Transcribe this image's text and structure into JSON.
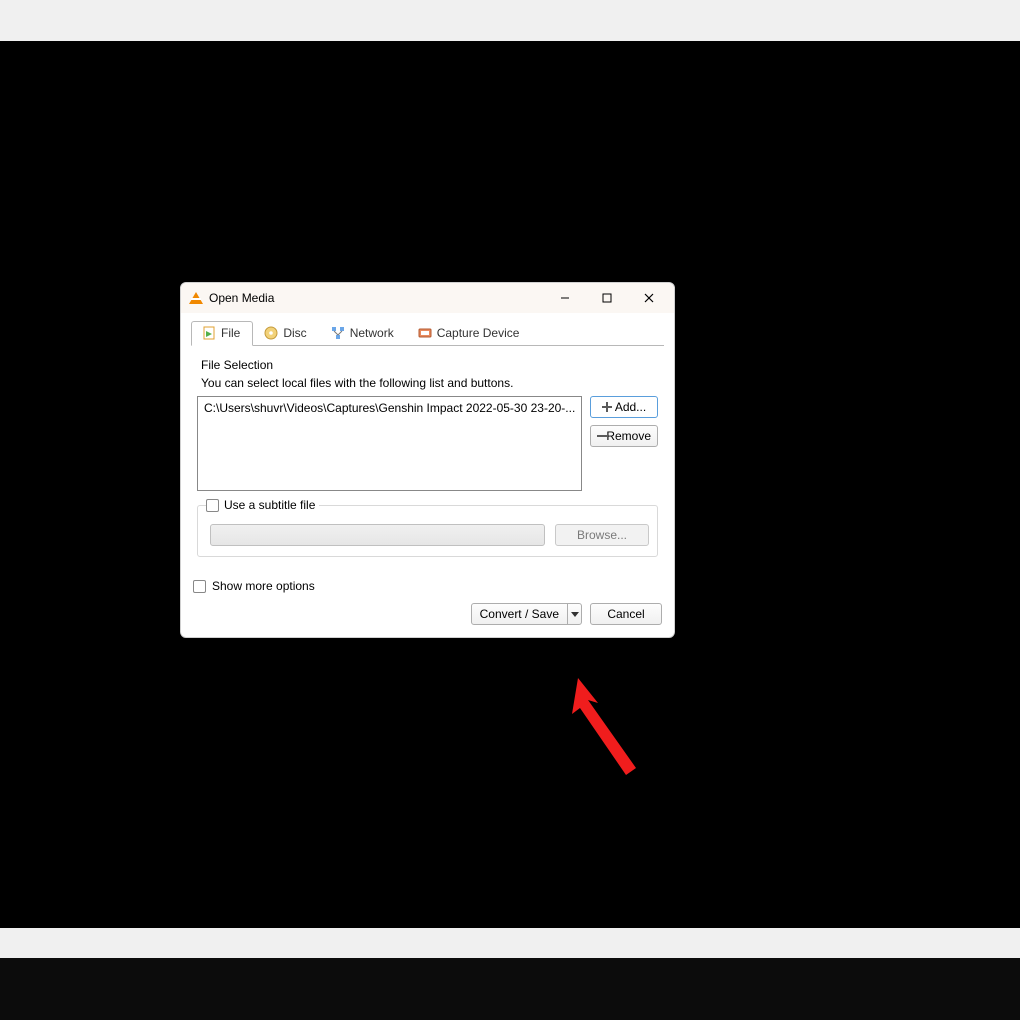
{
  "title": "Open Media",
  "tabs": {
    "file": "File",
    "disc": "Disc",
    "network": "Network",
    "capture": "Capture Device"
  },
  "file_section": {
    "label": "File Selection",
    "help": "You can select local files with the following list and buttons.",
    "entry": "C:\\Users\\shuvr\\Videos\\Captures\\Genshin Impact 2022-05-30 23-20-...",
    "add_label": "Add...",
    "remove_label": "Remove"
  },
  "subtitle": {
    "checkbox_label": "Use a subtitle file",
    "browse_label": "Browse..."
  },
  "options_label": "Show more options",
  "footer": {
    "convert_label": "Convert / Save",
    "cancel_label": "Cancel"
  }
}
